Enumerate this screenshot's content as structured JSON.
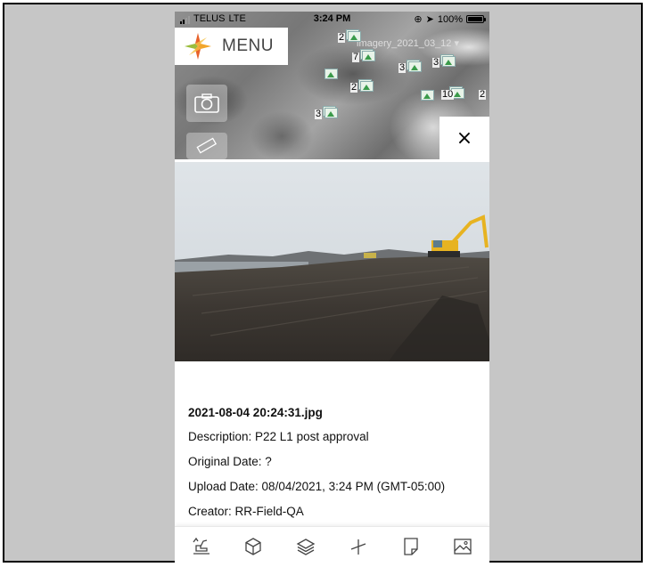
{
  "status_bar": {
    "carrier": "TELUS",
    "network": "LTE",
    "time": "3:24 PM",
    "battery": "100%"
  },
  "map": {
    "menu_label": "MENU",
    "imagery_label": "imagery_2021_03_12",
    "clusters": [
      {
        "count": "2"
      },
      {
        "count": "7"
      },
      {
        "count": "3"
      },
      {
        "count": "3"
      },
      {
        "count": "2"
      },
      {
        "count": "10"
      },
      {
        "count": "2"
      },
      {
        "count": "3"
      }
    ],
    "close_symbol": "×"
  },
  "photo_detail": {
    "filename": "2021-08-04 20:24:31.jpg",
    "description": "Description: P22 L1 post approval",
    "original_date": "Original Date: ?",
    "upload_date": "Upload Date: 08/04/2021, 3:24 PM (GMT-05:00)",
    "creator": "Creator: RR-Field-QA"
  },
  "toolbar": {
    "icons": [
      "excavator-icon",
      "cube-icon",
      "layers-icon",
      "measure-icon",
      "note-icon",
      "image-icon"
    ]
  },
  "colors": {
    "frame_bg": "#c6c6c6",
    "marker_green": "#3a9a4a"
  }
}
